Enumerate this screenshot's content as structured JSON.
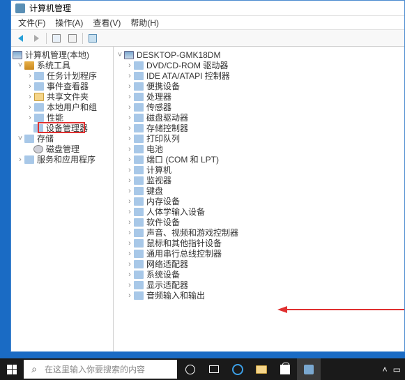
{
  "window": {
    "title": "计算机管理"
  },
  "menu": {
    "file": "文件(F)",
    "action": "操作(A)",
    "view": "查看(V)",
    "help": "帮助(H)"
  },
  "left_tree": {
    "root": "计算机管理(本地)",
    "tools": "系统工具",
    "task_sched": "任务计划程序",
    "event_viewer": "事件查看器",
    "shared": "共享文件夹",
    "users": "本地用户和组",
    "perf": "性能",
    "devmgr": "设备管理器",
    "storage": "存储",
    "diskmgmt": "磁盘管理",
    "services": "服务和应用程序"
  },
  "right_tree": {
    "host": "DESKTOP-GMK18DM",
    "items": [
      "DVD/CD-ROM 驱动器",
      "IDE ATA/ATAPI 控制器",
      "便携设备",
      "处理器",
      "传感器",
      "磁盘驱动器",
      "存储控制器",
      "打印队列",
      "电池",
      "端口 (COM 和 LPT)",
      "计算机",
      "监视器",
      "键盘",
      "内存设备",
      "人体学输入设备",
      "软件设备",
      "声音、视频和游戏控制器",
      "鼠标和其他指针设备",
      "通用串行总线控制器",
      "网络适配器",
      "系统设备",
      "显示适配器",
      "音频输入和输出"
    ]
  },
  "taskbar": {
    "search_placeholder": "在这里输入你要搜索的内容"
  }
}
